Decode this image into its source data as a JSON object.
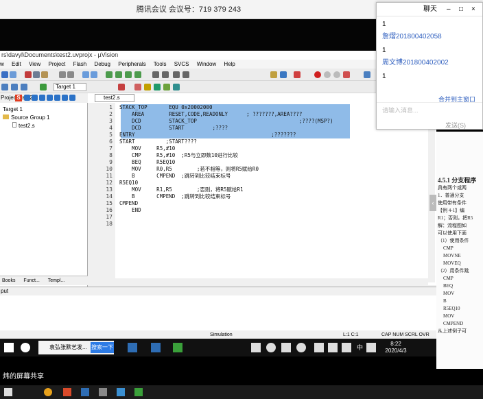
{
  "meeting": {
    "title": "腾讯会议 会议号：719 379 243"
  },
  "uvision": {
    "title": "rs\\davyl\\Documents\\test2.uvprojx - µVision",
    "menu": [
      "Project",
      "Flash",
      "Debug",
      "Peripherals",
      "Tools",
      "SVCS",
      "Window",
      "Help"
    ],
    "file_menu_prefix": "w",
    "target": "Target 1",
    "project_title": "Project: test2",
    "tree": {
      "target": "Target 1",
      "group": "Source Group 1",
      "file": "test2.s"
    },
    "panel_tabs": [
      "Books",
      "Funct...",
      "Templ..."
    ],
    "editor_tab": "test2.s",
    "line_numbers": [
      "1",
      "2",
      "3",
      "4",
      "5",
      "6",
      "7",
      "8",
      "9",
      "10",
      "11",
      "12",
      "13",
      "14",
      "15",
      "16",
      "17",
      "18"
    ],
    "code": [
      "STACK_TOP       EQU 0x20002000",
      "    AREA        RESET,CODE,READONLY      ; ???????,AREA????",
      "    DCD         STACK_TOP                                 ;????(MSP?)",
      "    DCD         START         ;????",
      "ENTRY                                            ;???????",
      "START          ;START????",
      "    MOV     R5,#10",
      "    CMP     R5,#10  ;R5与立即数10进行比较",
      "    BEQ     R5EQ10",
      "    MOV     R0,R5        ;若不相等，则将R5赋给R0",
      "    B       CMPEND  ;跳转到比较结束标号",
      "R5EQ10",
      "    MOV     R1,R5        ;否则，将R5赋给R1",
      "    B       CMPEND  ;跳转到比较结束标号",
      "CMPEND",
      "    END",
      "",
      ""
    ],
    "output_title": "put",
    "status": {
      "mode": "Simulation",
      "pos": "L:1 C:1",
      "keys": "CAP NUM SCRL OVR"
    }
  },
  "taskbar": {
    "search_label": "袁弘张默艺发...",
    "search_button": "搜索一下",
    "time": "8:22",
    "date": "2020/4/3",
    "ime": "中"
  },
  "share": {
    "label": "炜的屏幕共享"
  },
  "chat": {
    "title": "聊天",
    "messages": [
      "1",
      "詹熠201800402058",
      "1",
      "周文博201800402002",
      "1"
    ],
    "merge_link": "合并到主窗口",
    "input_placeholder": "请输入消息...",
    "send_label": "发送(S)"
  },
  "doc": {
    "section": "4.5.1 分支程序",
    "lines": [
      "具有两个或两",
      "1．普通分支",
      "使用带有条件",
      "【例 4-1】编",
      "R1；否则，把R5",
      "解：流程图如",
      "可以使用下面",
      "（1）使用条件",
      "CMP",
      "MOVNE",
      "MOVEQ",
      "（2）用条件跳",
      "CMP",
      "BEQ",
      "MOV",
      "B",
      "R5EQ10",
      "MOV",
      "CMPEND",
      "从上述例子可"
    ]
  },
  "colors": {
    "selection": "#8fbbe8",
    "accent": "#2f5fbf"
  }
}
